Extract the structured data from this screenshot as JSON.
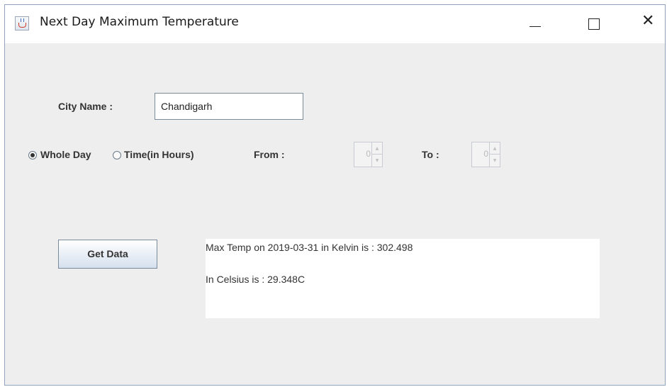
{
  "window": {
    "title": "Next Day Maximum Temperature",
    "icon": "java-icon",
    "controls": {
      "minimize": "—",
      "maximize": "☐",
      "close": "✕"
    }
  },
  "form": {
    "city_label": "City Name :",
    "city_value": "Chandigarh",
    "mode_options": [
      {
        "label": "Whole Day",
        "selected": true
      },
      {
        "label": "Time(in Hours)",
        "selected": false
      }
    ],
    "from_label": "From :",
    "from_value": "0",
    "to_label": "To :",
    "to_value": "0",
    "get_data_label": "Get Data"
  },
  "output": {
    "line1": "Max Temp on 2019-03-31 in Kelvin is : 302.498",
    "line2": "In Celsius is : 29.348C"
  },
  "colors": {
    "panel_background": "#eeeeee",
    "titlebar_background": "#ffffff",
    "button_gradient_bottom": "#d5e0ee"
  }
}
